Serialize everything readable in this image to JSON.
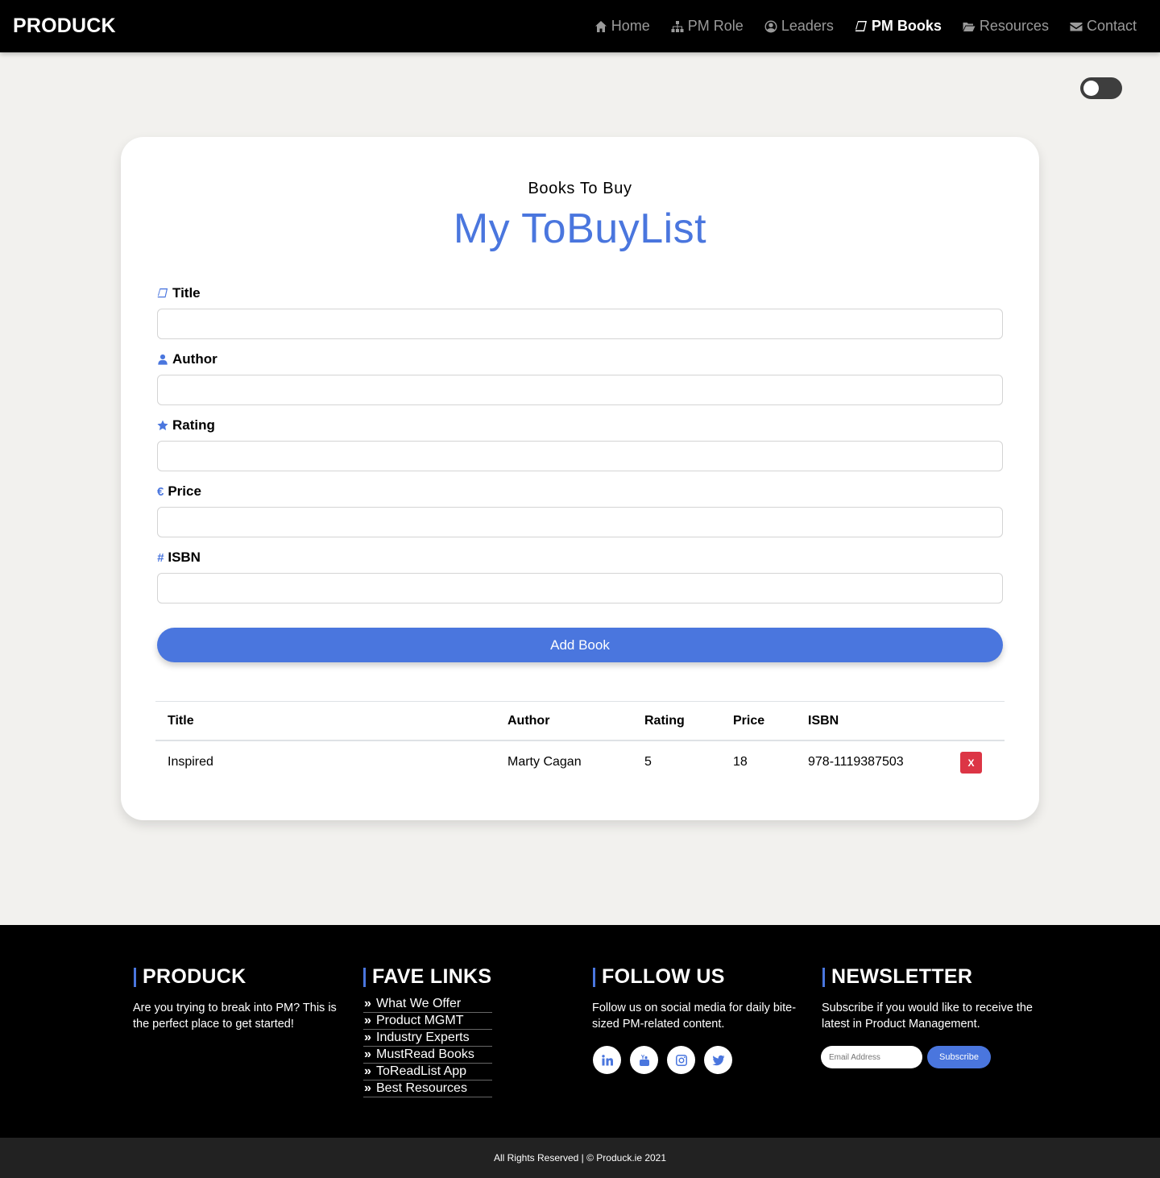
{
  "navbar": {
    "brand": "PRODUCK",
    "items": [
      {
        "label": "Home",
        "icon": "home-icon",
        "active": false
      },
      {
        "label": "PM Role",
        "icon": "sitemap-icon",
        "active": false
      },
      {
        "label": "Leaders",
        "icon": "user-circle-icon",
        "active": false
      },
      {
        "label": "PM Books",
        "icon": "book-icon",
        "active": true
      },
      {
        "label": "Resources",
        "icon": "folder-open-icon",
        "active": false
      },
      {
        "label": "Contact",
        "icon": "envelope-icon",
        "active": false
      }
    ]
  },
  "theme_toggle": {
    "state": "off"
  },
  "form": {
    "subtitle": "Books To Buy",
    "title": "My ToBuyList",
    "fields": [
      {
        "label": "Title",
        "icon": "book-icon",
        "value": "",
        "placeholder": ""
      },
      {
        "label": "Author",
        "icon": "user-icon",
        "value": "",
        "placeholder": ""
      },
      {
        "label": "Rating",
        "icon": "star-icon",
        "value": "",
        "placeholder": ""
      },
      {
        "label": "Price",
        "icon": "euro-icon",
        "value": "",
        "placeholder": ""
      },
      {
        "label": "ISBN",
        "icon": "hashtag-icon",
        "value": "",
        "placeholder": ""
      }
    ],
    "submit_label": "Add Book"
  },
  "table": {
    "headers": [
      "Title",
      "Author",
      "Rating",
      "Price",
      "ISBN"
    ],
    "rows": [
      {
        "title": "Inspired",
        "author": "Marty Cagan",
        "rating": "5",
        "price": "18",
        "isbn": "978-1119387503",
        "delete_label": "X"
      }
    ]
  },
  "footer": {
    "about": {
      "heading": "PRODUCK",
      "text": "Are you trying to break into PM? This is the perfect place to get started!"
    },
    "links": {
      "heading": "FAVE LINKS",
      "arrow": "»",
      "items": [
        "What We Offer",
        "Product MGMT",
        "Industry Experts",
        "MustRead Books",
        "ToReadList App",
        "Best Resources"
      ]
    },
    "follow": {
      "heading": "FOLLOW US",
      "text": "Follow us on social media for daily bite-sized PM-related content.",
      "socials": [
        "linkedin-icon",
        "youtube-icon",
        "instagram-icon",
        "twitter-icon"
      ]
    },
    "newsletter": {
      "heading": "NEWSLETTER",
      "text": "Subscribe if you would like to receive the latest in Product Management.",
      "email_placeholder": "Email Address",
      "button_label": "Subscribe"
    },
    "copyright": "All Rights Reserved | © Produck.ie 2021"
  },
  "colors": {
    "accent": "#4a76de",
    "danger": "#dc3545",
    "page_bg": "#f2f1ee",
    "nav_bg": "#000000"
  }
}
